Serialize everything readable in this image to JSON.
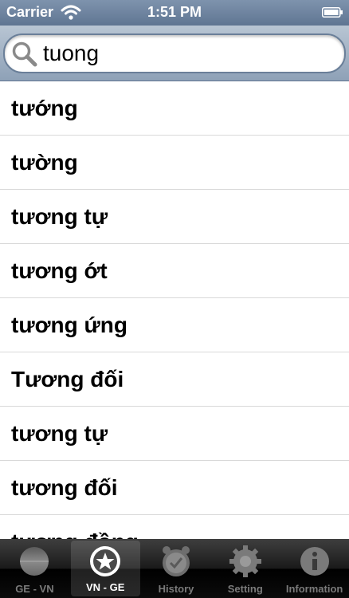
{
  "status": {
    "carrier": "Carrier",
    "time": "1:51 PM"
  },
  "search": {
    "value": "tuong",
    "icon": "search-icon"
  },
  "results": [
    "tướng",
    "tường",
    "tương tự",
    "tương ớt",
    "tương ứng",
    "Tương đối",
    "tương tự",
    "tương đối",
    "tương đồng"
  ],
  "tabs": [
    {
      "label": "GE - VN",
      "icon": "flag-icon",
      "selected": false
    },
    {
      "label": "VN - GE",
      "icon": "star-icon",
      "selected": true
    },
    {
      "label": "History",
      "icon": "clock-icon",
      "selected": false
    },
    {
      "label": "Setting",
      "icon": "gear-icon",
      "selected": false
    },
    {
      "label": "Information",
      "icon": "info-icon",
      "selected": false
    }
  ]
}
